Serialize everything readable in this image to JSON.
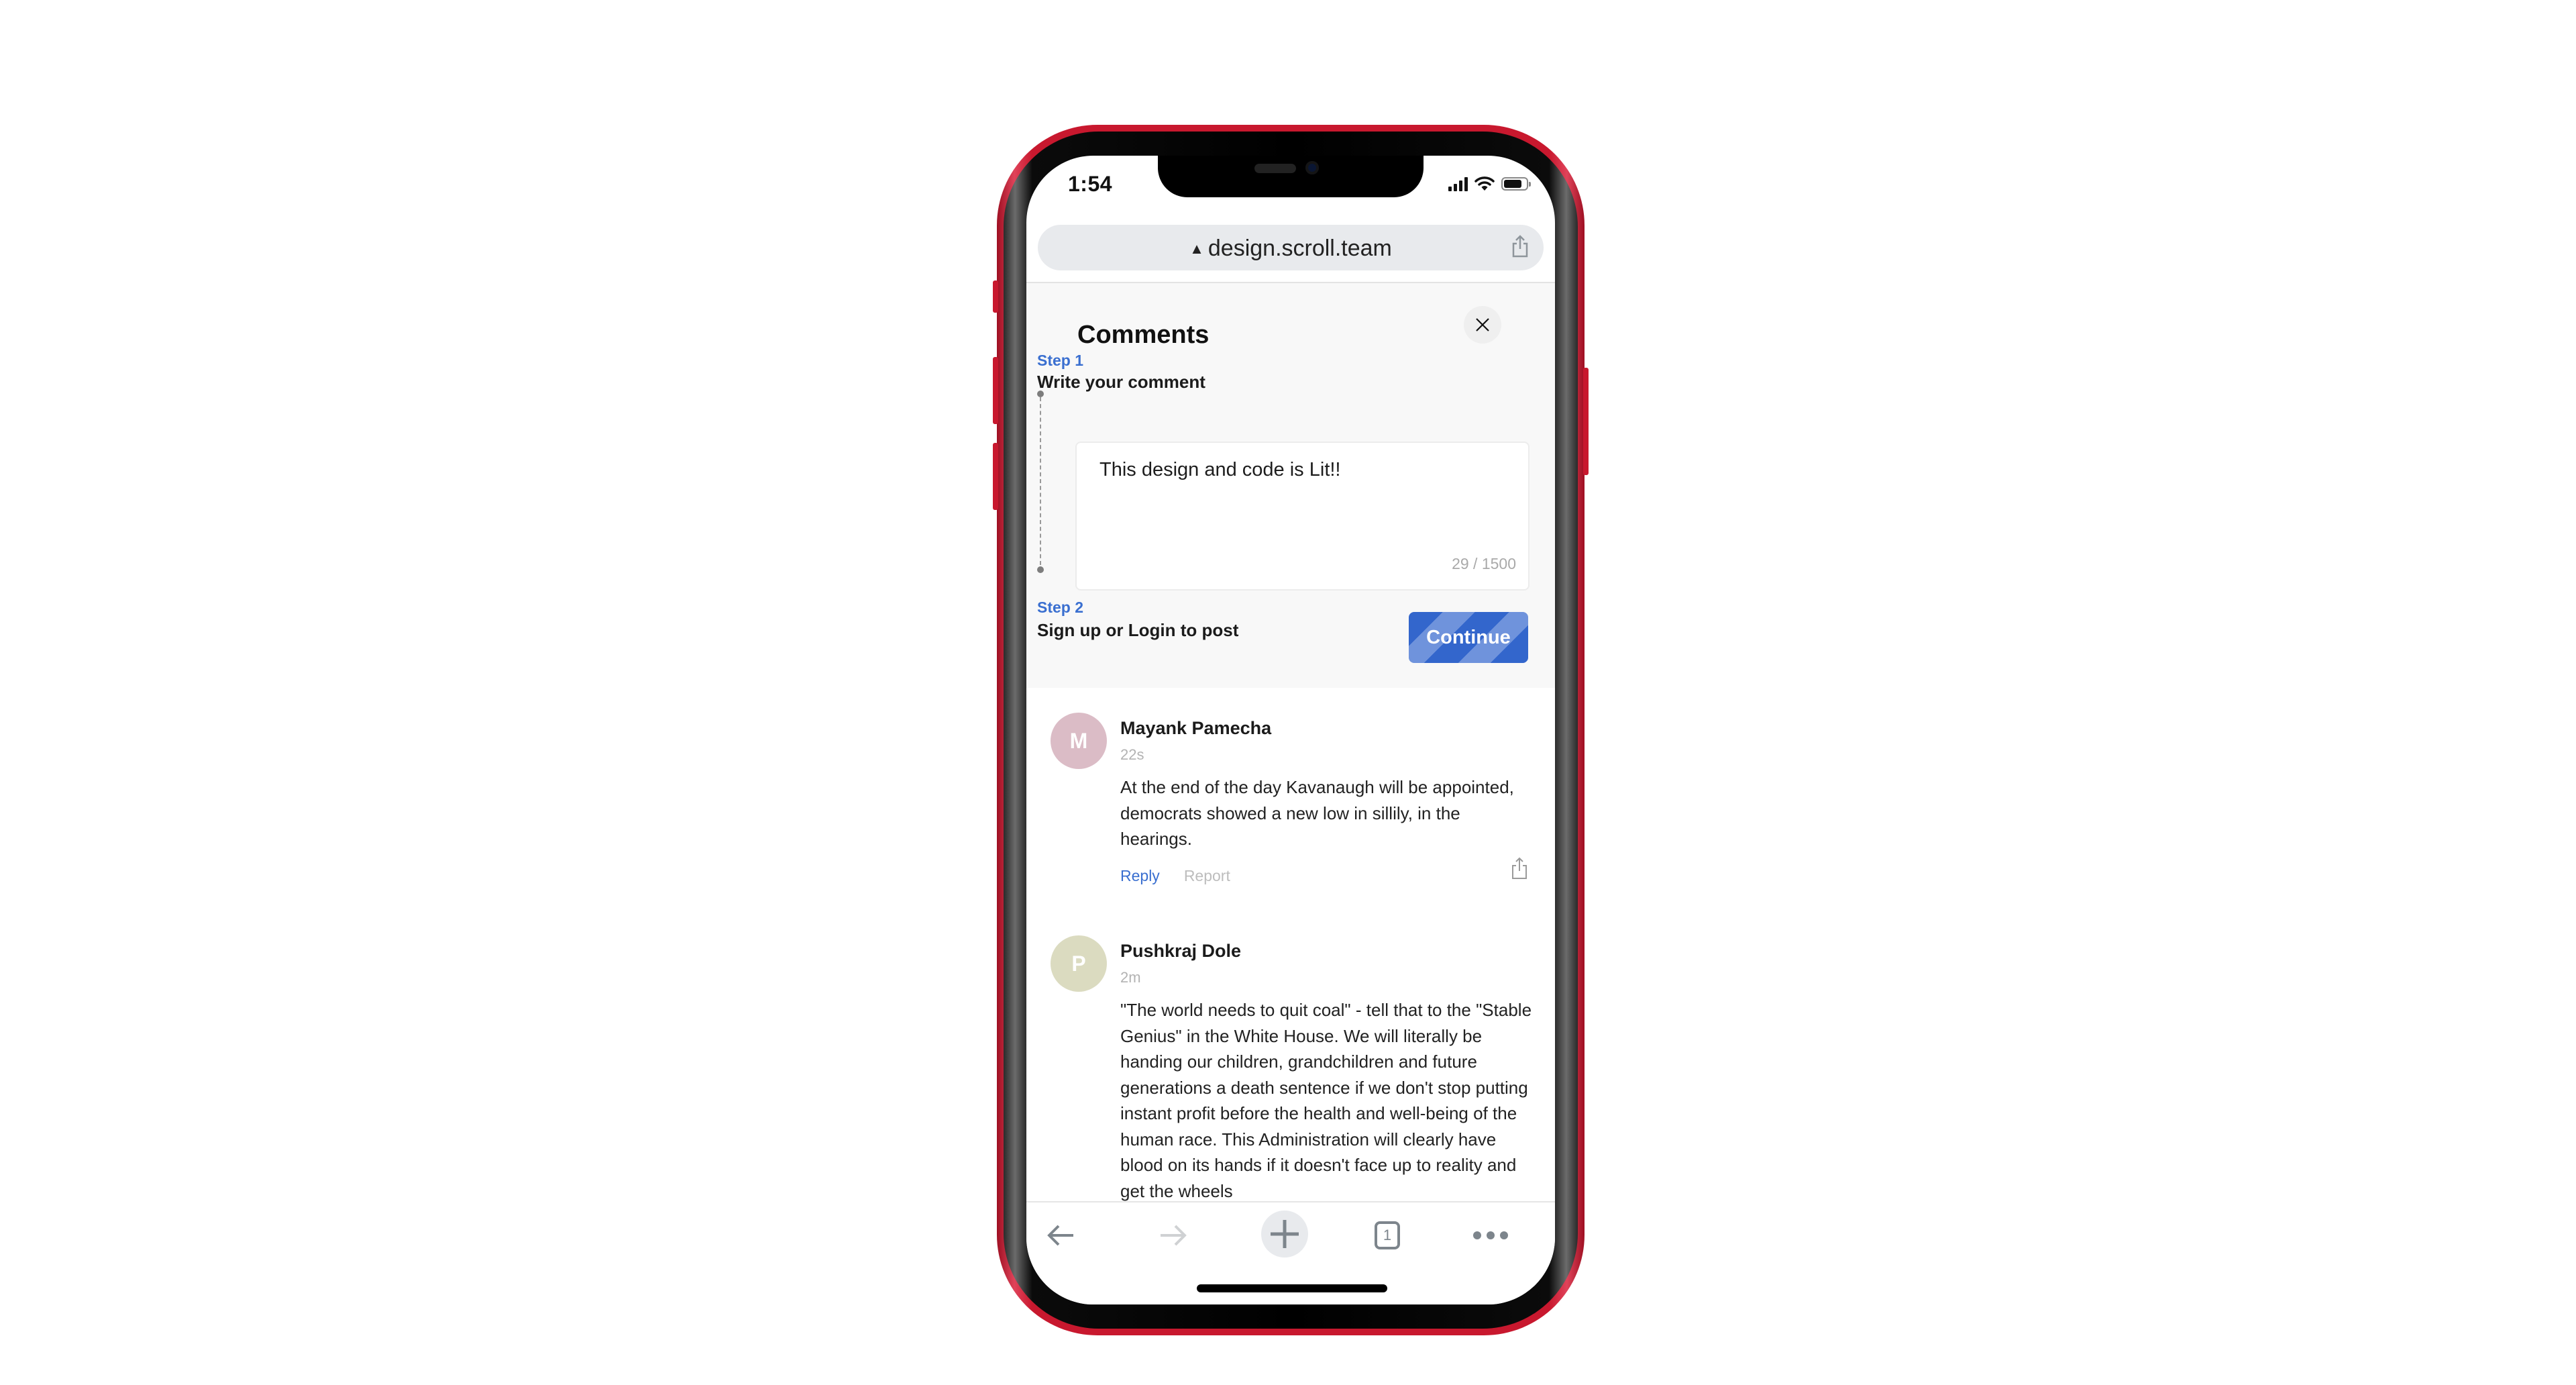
{
  "device": {
    "frame_color": "#c8182e",
    "status_bar": {
      "time": "1:54",
      "signal_icon": "cellular-signal-icon",
      "wifi_icon": "wifi-icon",
      "battery_icon": "battery-icon"
    }
  },
  "browser": {
    "url": "design.scroll.team",
    "url_prefix_icon": "warning-triangle-icon",
    "share_icon": "share-icon",
    "toolbar": {
      "back_icon": "arrow-left-icon",
      "forward_icon": "arrow-right-icon",
      "new_tab_icon": "plus-icon",
      "tab_count": "1",
      "more_icon": "more-dots-icon"
    }
  },
  "comments_panel": {
    "title": "Comments",
    "close_icon": "close-icon",
    "step1": {
      "label": "Step 1",
      "title": "Write your comment"
    },
    "textarea": {
      "value": "This design and code is Lit!!",
      "counter": "29 / 1500"
    },
    "step2": {
      "label": "Step 2",
      "title": "Sign up or Login to post"
    },
    "continue_label": "Continue",
    "accent_color": "#3366cc"
  },
  "comments": [
    {
      "initial": "M",
      "avatar_color": "#dbbcc6",
      "name": "Mayank Pamecha",
      "time": "22s",
      "body": "At the end of the day Kavanaugh will be appointed, democrats showed a new low in sillily, in the hearings.",
      "reply_label": "Reply",
      "report_label": "Report"
    },
    {
      "initial": "P",
      "avatar_color": "#dbdbc0",
      "name": "Pushkraj Dole",
      "time": "2m",
      "body": "\"The world needs to quit coal\" - tell that to the \"Stable Genius\" in the White House. We will literally be handing our children, grandchildren and future generations a death sentence if we don't stop putting instant profit before the health and well-being of the human race. This Administration will clearly have blood on its hands if it doesn't face up to reality and get the wheels"
    }
  ]
}
